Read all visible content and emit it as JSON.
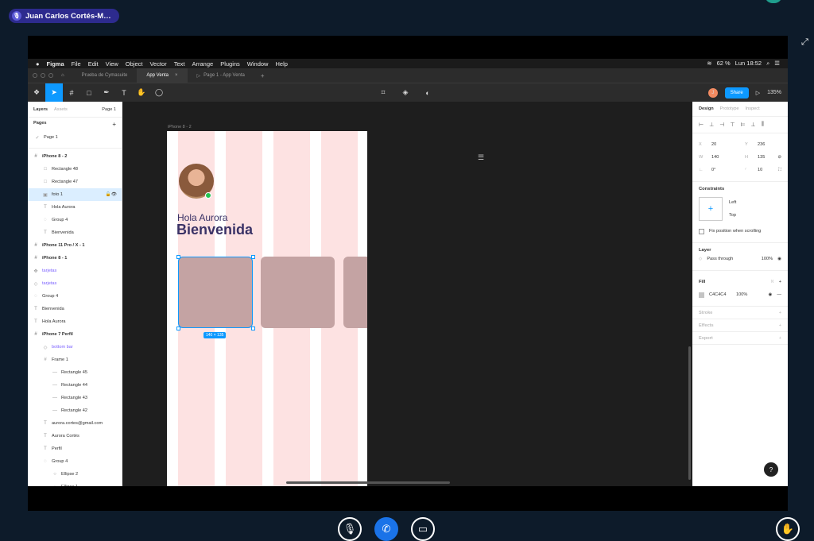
{
  "meeting": {
    "speaker": "Juan Carlos Cortés-M…"
  },
  "macmenu": {
    "app": "Figma",
    "items": [
      "File",
      "Edit",
      "View",
      "Object",
      "Vector",
      "Text",
      "Arrange",
      "Plugins",
      "Window",
      "Help"
    ],
    "battery": "62 %",
    "clock": "Lun 18:52"
  },
  "tabs": {
    "file1": "Prueba de Cymasuite",
    "file2": "App Venta",
    "file3": "Page 1 - App Venta"
  },
  "toolbar": {
    "share": "Share",
    "zoom": "135%",
    "avatar": "J"
  },
  "layers": {
    "tab_layers": "Layers",
    "tab_assets": "Assets",
    "page_select": "Page 1",
    "pages_title": "Pages",
    "page1": "Page 1",
    "rows": [
      {
        "label": "iPhone 8 - 2",
        "indent": 0,
        "icon": "#",
        "style": "bold"
      },
      {
        "label": "Rectangle 48",
        "indent": 1,
        "icon": "□",
        "style": ""
      },
      {
        "label": "Rectangle 47",
        "indent": 1,
        "icon": "□",
        "style": ""
      },
      {
        "label": "foto 1",
        "indent": 1,
        "icon": "▣",
        "style": "sel"
      },
      {
        "label": "Hola Aurora",
        "indent": 1,
        "icon": "T",
        "style": ""
      },
      {
        "label": "Group 4",
        "indent": 1,
        "icon": "◌",
        "style": ""
      },
      {
        "label": "Bienvenida",
        "indent": 1,
        "icon": "T",
        "style": ""
      },
      {
        "label": "iPhone 11 Pro / X - 1",
        "indent": 0,
        "icon": "#",
        "style": "bold"
      },
      {
        "label": "iPhone 8 - 1",
        "indent": 0,
        "icon": "#",
        "style": "bold"
      },
      {
        "label": "tarjetas",
        "indent": 0,
        "icon": "✥",
        "style": "purple"
      },
      {
        "label": "tarjetas",
        "indent": 0,
        "icon": "◇",
        "style": "purple"
      },
      {
        "label": "Group 4",
        "indent": 0,
        "icon": "◌",
        "style": ""
      },
      {
        "label": "Bienvenida",
        "indent": 0,
        "icon": "T",
        "style": ""
      },
      {
        "label": "Hola Aurora",
        "indent": 0,
        "icon": "T",
        "style": ""
      },
      {
        "label": "iPhone 7 Perfil",
        "indent": 0,
        "icon": "#",
        "style": "bold"
      },
      {
        "label": "bottom bar",
        "indent": 1,
        "icon": "◇",
        "style": "purple"
      },
      {
        "label": "Frame 1",
        "indent": 1,
        "icon": "#",
        "style": ""
      },
      {
        "label": "Rectangle 45",
        "indent": 2,
        "icon": "—",
        "style": ""
      },
      {
        "label": "Rectangle 44",
        "indent": 2,
        "icon": "—",
        "style": ""
      },
      {
        "label": "Rectangle 43",
        "indent": 2,
        "icon": "—",
        "style": ""
      },
      {
        "label": "Rectangle 42",
        "indent": 2,
        "icon": "—",
        "style": ""
      },
      {
        "label": "aurora.cortes@gmail.com",
        "indent": 1,
        "icon": "T",
        "style": ""
      },
      {
        "label": "Aurora Cortés",
        "indent": 1,
        "icon": "T",
        "style": ""
      },
      {
        "label": "Perfil",
        "indent": 1,
        "icon": "T",
        "style": ""
      },
      {
        "label": "Group 4",
        "indent": 1,
        "icon": "◌",
        "style": ""
      },
      {
        "label": "Ellipse 2",
        "indent": 2,
        "icon": "○",
        "style": ""
      },
      {
        "label": "Ellipse 1",
        "indent": 2,
        "icon": "○",
        "style": ""
      }
    ]
  },
  "canvas": {
    "frame_label": "iPhone 8 - 2",
    "greeting": "Hola Aurora",
    "welcome": "Bienvenida",
    "size_badge": "140 × 135"
  },
  "design": {
    "tab_design": "Design",
    "tab_prototype": "Prototype",
    "tab_inspect": "Inspect",
    "x": "20",
    "y": "236",
    "w": "140",
    "h": "135",
    "rot": "0°",
    "radius": "10",
    "constraints_title": "Constraints",
    "c_h": "Left",
    "c_v": "Top",
    "fix_scroll": "Fix position when scrolling",
    "layer_title": "Layer",
    "blend": "Pass through",
    "layer_opacity": "100%",
    "fill_title": "Fill",
    "fill_hex": "C4C4C4",
    "fill_opacity": "100%",
    "stroke": "Stroke",
    "effects": "Effects",
    "export": "Export"
  },
  "colors": {
    "accent": "#0d99ff",
    "column": "#fde2e2",
    "card": "#c4a3a3",
    "speaker_bg": "#2d2b8e"
  }
}
